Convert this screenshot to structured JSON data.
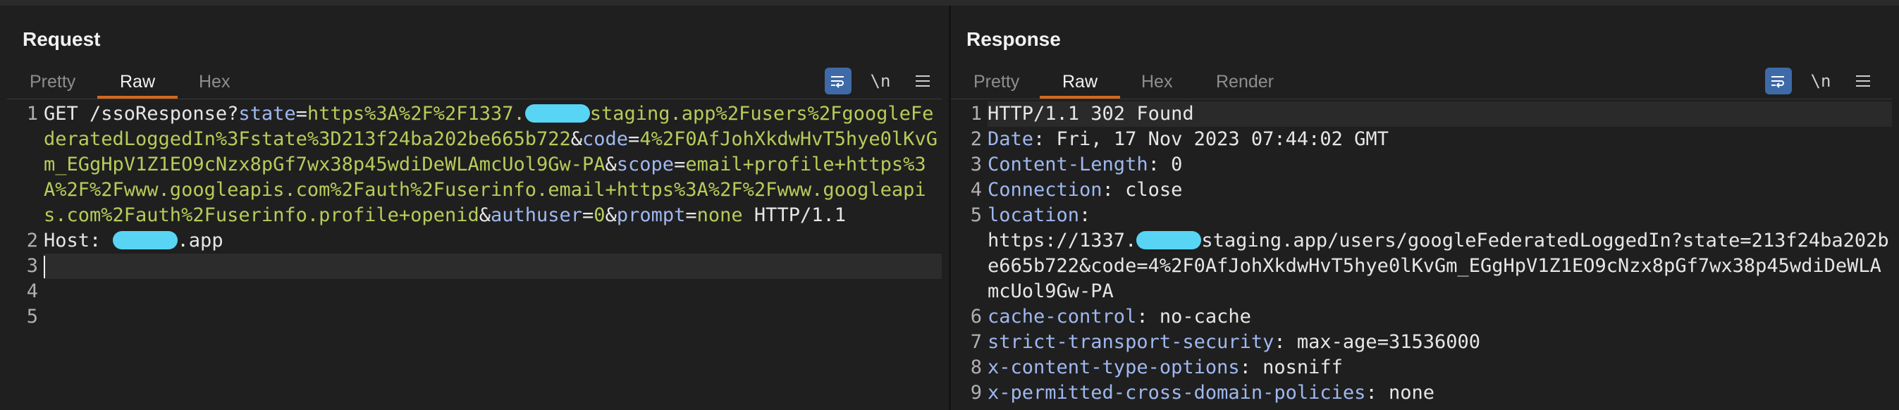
{
  "request": {
    "title": "Request",
    "tabs": [
      "Pretty",
      "Raw",
      "Hex"
    ],
    "active_tab": "Raw",
    "tools": {
      "wrap": "wrap-lines-icon",
      "newline": "\\n",
      "menu": "menu-icon"
    },
    "lines": [
      {
        "n": "1",
        "segs": [
          {
            "c": "m",
            "t": "GET /ssoResponse?"
          },
          {
            "c": "k",
            "t": "state"
          },
          {
            "c": "m",
            "t": "="
          },
          {
            "c": "v",
            "t": "https%3A%2F%2F1337."
          },
          {
            "c": "r"
          },
          {
            "c": "v",
            "t": "staging.app%2Fusers%2FgoogleFederatedLoggedIn%3Fstate%3D213f24ba202be665b722"
          },
          {
            "c": "m",
            "t": "&"
          },
          {
            "c": "k",
            "t": "code"
          },
          {
            "c": "m",
            "t": "="
          },
          {
            "c": "v",
            "t": "4%2F0AfJohXkdwHvT5hye0lKvGm_EGgHpV1Z1EO9cNzx8pGf7wx38p45wdiDeWLAmcUol9Gw-PA"
          },
          {
            "c": "m",
            "t": "&"
          },
          {
            "c": "k",
            "t": "scope"
          },
          {
            "c": "m",
            "t": "="
          },
          {
            "c": "v",
            "t": "email+profile+https%3A%2F%2Fwww.googleapis.com%2Fauth%2Fuserinfo.email+https%3A%2F%2Fwww.googleapis.com%2Fauth%2Fuserinfo.profile+openid"
          },
          {
            "c": "m",
            "t": "&"
          },
          {
            "c": "k",
            "t": "authuser"
          },
          {
            "c": "m",
            "t": "="
          },
          {
            "c": "v",
            "t": "0"
          },
          {
            "c": "m",
            "t": "&"
          },
          {
            "c": "k",
            "t": "prompt"
          },
          {
            "c": "m",
            "t": "="
          },
          {
            "c": "v",
            "t": "none"
          },
          {
            "c": "m",
            "t": " HTTP/1.1"
          }
        ]
      },
      {
        "n": "2",
        "segs": [
          {
            "c": "m",
            "t": "Host: "
          },
          {
            "c": "r"
          },
          {
            "c": "m",
            "t": ".app"
          }
        ]
      },
      {
        "n": "3",
        "segs": [],
        "cursor": true
      },
      {
        "n": "4",
        "segs": []
      },
      {
        "n": "5",
        "segs": []
      }
    ]
  },
  "response": {
    "title": "Response",
    "tabs": [
      "Pretty",
      "Raw",
      "Hex",
      "Render"
    ],
    "active_tab": "Raw",
    "tools": {
      "wrap": "wrap-lines-icon",
      "newline": "\\n",
      "menu": "menu-icon"
    },
    "lines": [
      {
        "n": "1",
        "hl": true,
        "segs": [
          {
            "c": "m",
            "t": "HTTP/1.1 302 Found"
          }
        ]
      },
      {
        "n": "2",
        "segs": [
          {
            "c": "h",
            "t": "Date"
          },
          {
            "c": "m",
            "t": ": Fri, 17 Nov 2023 07:44:02 GMT"
          }
        ]
      },
      {
        "n": "3",
        "segs": [
          {
            "c": "h",
            "t": "Content-Length"
          },
          {
            "c": "m",
            "t": ": 0"
          }
        ]
      },
      {
        "n": "4",
        "segs": [
          {
            "c": "h",
            "t": "Connection"
          },
          {
            "c": "m",
            "t": ": close"
          }
        ]
      },
      {
        "n": "5",
        "segs": [
          {
            "c": "h",
            "t": "location"
          },
          {
            "c": "m",
            "t": ":\nhttps://1337."
          },
          {
            "c": "r"
          },
          {
            "c": "m",
            "t": "staging.app/users/googleFederatedLoggedIn?state=213f24ba202be665b722&code=4%2F0AfJohXkdwHvT5hye0lKvGm_EGgHpV1Z1EO9cNzx8pGf7wx38p45wdiDeWLAmcUol9Gw-PA"
          }
        ]
      },
      {
        "n": "6",
        "segs": [
          {
            "c": "h",
            "t": "cache-control"
          },
          {
            "c": "m",
            "t": ": no-cache"
          }
        ]
      },
      {
        "n": "7",
        "segs": [
          {
            "c": "h",
            "t": "strict-transport-security"
          },
          {
            "c": "m",
            "t": ": max-age=31536000"
          }
        ]
      },
      {
        "n": "8",
        "segs": [
          {
            "c": "h",
            "t": "x-content-type-options"
          },
          {
            "c": "m",
            "t": ": nosniff"
          }
        ]
      },
      {
        "n": "9",
        "segs": [
          {
            "c": "h",
            "t": "x-permitted-cross-domain-policies"
          },
          {
            "c": "m",
            "t": ": none"
          }
        ]
      }
    ]
  },
  "layout_switch": [
    "split-horizontal-icon",
    "split-vertical-icon",
    "single-pane-icon"
  ],
  "colors": {
    "accent": "#d2691e",
    "active_blue": "#3e6aa8",
    "redaction": "#58d5f5"
  }
}
